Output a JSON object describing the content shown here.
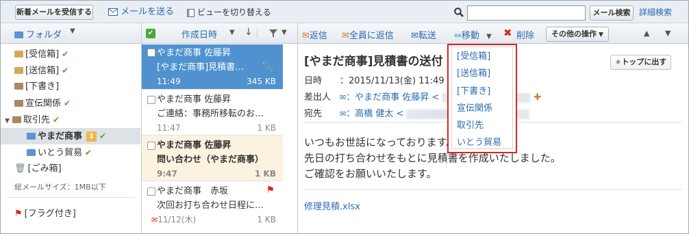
{
  "topbar": {
    "receive_button": "新着メールを受信する",
    "compose_link": "メールを送る",
    "view_switch_link": "ビューを切り替える",
    "search_placeholder": "",
    "search_button": "メール検索",
    "advanced_search_link": "詳細検索"
  },
  "folder_header": {
    "label": "フォルダ"
  },
  "folders": [
    {
      "label": "[受信箱]"
    },
    {
      "label": "[送信箱]"
    },
    {
      "label": "[下書き]"
    },
    {
      "label": "宣伝関係"
    },
    {
      "label": "取引先"
    },
    {
      "label": "やまだ商事",
      "badge": "1"
    },
    {
      "label": "いとう貿易"
    },
    {
      "label": "[ごみ箱]"
    }
  ],
  "mailbox_size": "総メールサイズ：1MB以下",
  "flagged_folder": "[フラグ付き]",
  "list_header": {
    "sort_label": "作成日時"
  },
  "messages": [
    {
      "sender": "やまだ商事 佐藤昇",
      "subject": "[やまだ商事]見積書…",
      "time": "11:49",
      "size": "345 KB"
    },
    {
      "sender": "やまだ商事 佐藤昇",
      "subject": "ご連絡：事務所移転のお…",
      "time": "11:47",
      "size": "1 KB"
    },
    {
      "sender": "やまだ商事 佐藤昇",
      "subject": "問い合わせ（やまだ商事）",
      "time": "9:47",
      "size": "1 KB"
    },
    {
      "sender": "やまだ商事　赤坂",
      "subject": "次回お打ち合わせ日程に…",
      "time": "11/12(木)",
      "size": "1 KB"
    }
  ],
  "actions": {
    "reply": "返信",
    "reply_all": "全員に返信",
    "forward": "転送",
    "move": "移動",
    "delete": "削除",
    "other": "その他の操作"
  },
  "reading": {
    "subject": "[やまだ商事]見積書の送付",
    "date_label": "日時",
    "date_value": "：2015/11/13(金) 11:49",
    "from_label": "差出人",
    "from_value": "：やまだ商事 佐藤昇 <",
    "to_label": "宛先",
    "to_value": "：高橋 健太 <",
    "body": [
      "いつもお世話になっております。",
      "先日の打ち合わせをもとに見積書を作成いたしました。",
      "ご確認をお願いいたします。"
    ],
    "attachment": "修理見積.xlsx",
    "pin_button": "トップに出す"
  },
  "move_menu": {
    "items": [
      "[受信箱]",
      "[送信箱]",
      "[下書き]",
      "宣伝関係",
      "取引先",
      "いとう貿易"
    ]
  },
  "colors": {
    "selected_row": "#4f92cf",
    "unread_row": "#fbf3df",
    "link": "#2a6ab0",
    "highlight_border": "#e0221a"
  }
}
